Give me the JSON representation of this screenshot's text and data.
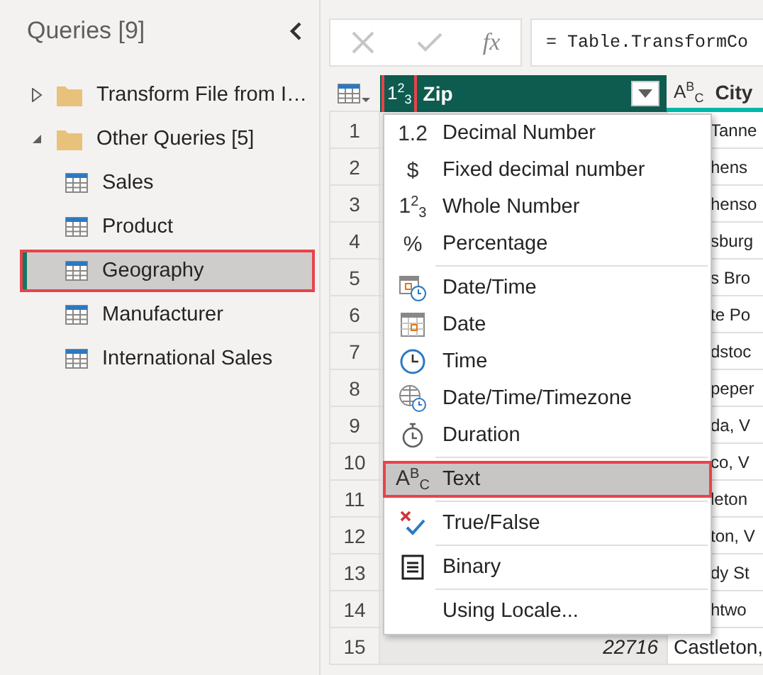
{
  "queries_panel": {
    "title": "Queries [9]",
    "tree": [
      {
        "label": "Transform File from I…",
        "kind": "folder",
        "expanded": false,
        "selected": false
      },
      {
        "label": "Other Queries [5]",
        "kind": "folder",
        "expanded": true,
        "selected": false,
        "children": [
          {
            "label": "Sales",
            "kind": "table",
            "selected": false
          },
          {
            "label": "Product",
            "kind": "table",
            "selected": false
          },
          {
            "label": "Geography",
            "kind": "table",
            "selected": true
          },
          {
            "label": "Manufacturer",
            "kind": "table",
            "selected": false
          },
          {
            "label": "International Sales",
            "kind": "table",
            "selected": false
          }
        ]
      }
    ]
  },
  "formula_bar": {
    "function_label": "fx",
    "formula": "= Table.TransformCo"
  },
  "grid": {
    "columns": [
      {
        "label": "Zip",
        "type_glyph": "1$^{2}$$_{3}$",
        "selected": true,
        "highlighted": true
      },
      {
        "label": "City",
        "type_glyph": "A$^{B}$$_{C}$",
        "selected": false,
        "highlighted": false
      }
    ],
    "rows": [
      {
        "number": "1",
        "city": "Tanne"
      },
      {
        "number": "2",
        "city": "hens"
      },
      {
        "number": "3",
        "city": "henso"
      },
      {
        "number": "4",
        "city": "sburg"
      },
      {
        "number": "5",
        "city": "s Bro"
      },
      {
        "number": "6",
        "city": "te Po"
      },
      {
        "number": "7",
        "city": "dstoc"
      },
      {
        "number": "8",
        "city": "peper"
      },
      {
        "number": "9",
        "city": "da, V"
      },
      {
        "number": "10",
        "city": "co, V"
      },
      {
        "number": "11",
        "city": "leton"
      },
      {
        "number": "12",
        "city": "ton, V"
      },
      {
        "number": "13",
        "city": "dy St"
      },
      {
        "number": "14",
        "city": "htwo"
      },
      {
        "number": "15",
        "zip": "22716",
        "city": "Castleton,"
      }
    ]
  },
  "type_menu": {
    "groups": [
      [
        {
          "label": "Decimal Number",
          "glyph": "1.2",
          "selected": false
        },
        {
          "label": "Fixed decimal number",
          "glyph": "$",
          "selected": false
        },
        {
          "label": "Whole Number",
          "glyph": "1$^{2}$$_{3}$",
          "selected": false
        },
        {
          "label": "Percentage",
          "glyph": "%",
          "selected": false
        }
      ],
      [
        {
          "label": "Date/Time",
          "kind": "datetime",
          "selected": false
        },
        {
          "label": "Date",
          "kind": "date",
          "selected": false
        },
        {
          "label": "Time",
          "kind": "time",
          "selected": false
        },
        {
          "label": "Date/Time/Timezone",
          "kind": "timezone",
          "selected": false
        },
        {
          "label": "Duration",
          "kind": "duration",
          "selected": false
        }
      ],
      [
        {
          "label": "Text",
          "glyph": "A$^{B}$$_{C}$",
          "selected": true
        }
      ],
      [
        {
          "label": "True/False",
          "kind": "truefalse",
          "selected": false
        }
      ],
      [
        {
          "label": "Binary",
          "kind": "binary",
          "selected": false
        }
      ],
      [
        {
          "label": "Using Locale...",
          "selected": false
        }
      ]
    ]
  }
}
